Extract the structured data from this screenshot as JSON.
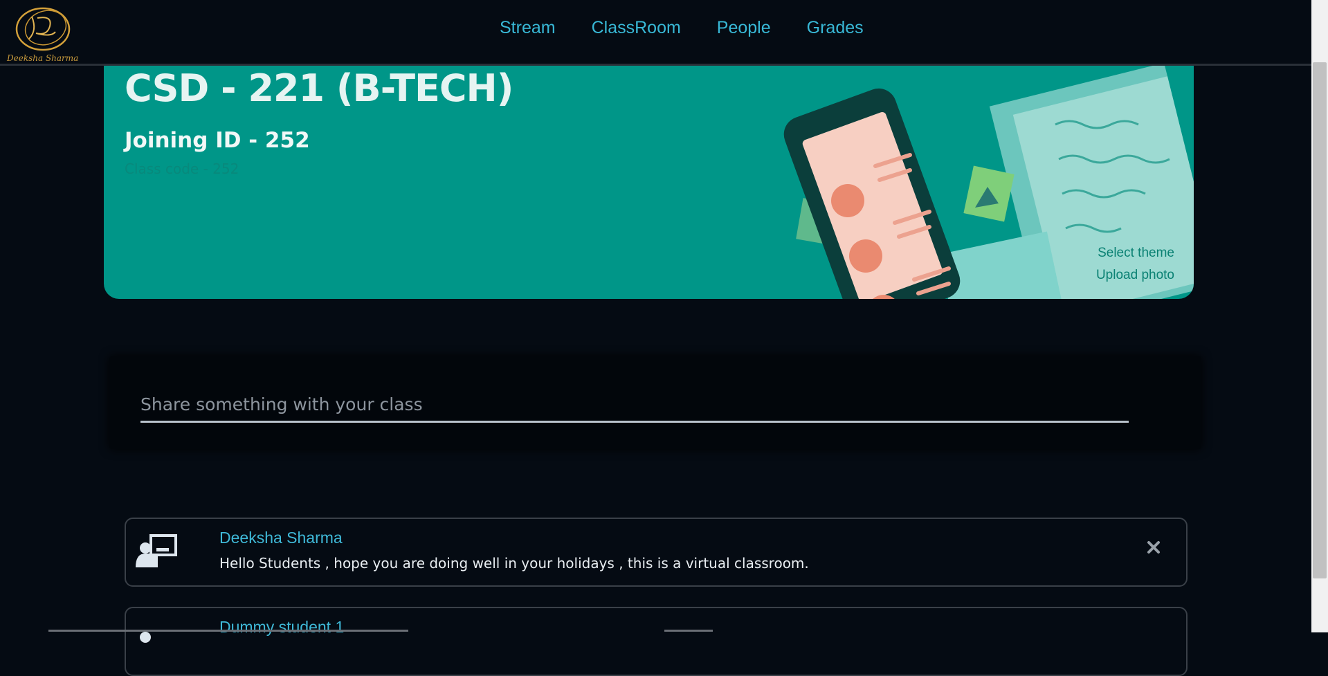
{
  "brand": {
    "logo_text": "Deeksha Sharma"
  },
  "nav": {
    "items": [
      "Stream",
      "ClassRoom",
      "People",
      "Grades"
    ]
  },
  "banner": {
    "title": "CSD - 221 (B-TECH)",
    "joining_id": "Joining ID - 252",
    "faded_text": "Class code - 252",
    "select_theme": "Select theme",
    "upload_photo": "Upload photo"
  },
  "share": {
    "placeholder": "Share something with your class"
  },
  "posts": [
    {
      "author": "Deeksha Sharma",
      "text": "Hello Students , hope you are doing well in your holidays , this is a virtual classroom."
    },
    {
      "author": "Dummy student 1",
      "text": ""
    }
  ],
  "colors": {
    "accent": "#38b8d6",
    "banner": "#009688",
    "background": "#050b13"
  }
}
